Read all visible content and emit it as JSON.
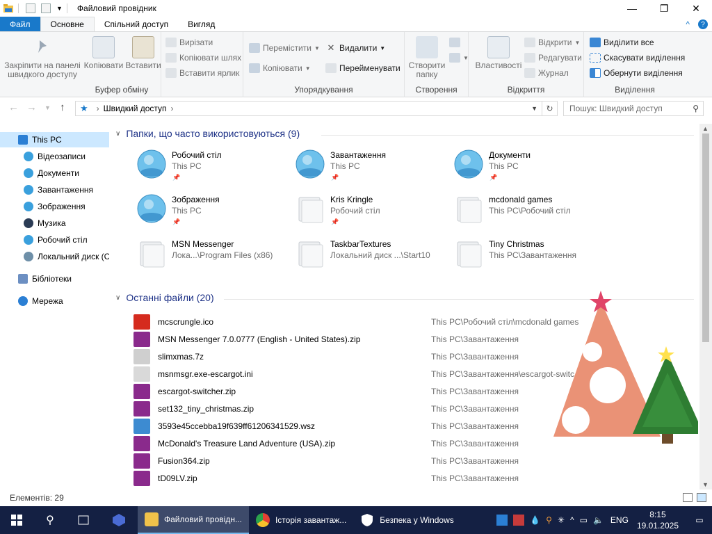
{
  "window": {
    "title": "Файловий провідник",
    "minimize": "—",
    "maximize": "❐",
    "close": "✕"
  },
  "tabs": [
    {
      "label": "Файл"
    },
    {
      "label": "Основне"
    },
    {
      "label": "Спільний доступ"
    },
    {
      "label": "Вигляд"
    }
  ],
  "ribbon": {
    "clipboard": {
      "label": "Буфер обміну",
      "pin_quick": "Закріпити на панелі швидкого доступу",
      "copy": "Копіювати",
      "paste": "Вставити",
      "cut": "Вирізати",
      "copy_path": "Копіювати шлях",
      "paste_shortcut": "Вставити ярлик"
    },
    "organize": {
      "label": "Упорядкування",
      "move_to": "Перемістити",
      "copy_to": "Копіювати",
      "delete": "Видалити",
      "rename": "Перейменувати"
    },
    "new": {
      "label": "Створення",
      "new_folder": "Створити папку"
    },
    "open": {
      "label": "Відкриття",
      "properties": "Властивості",
      "open": "Відкрити",
      "edit": "Редагувати",
      "history": "Журнал"
    },
    "select": {
      "label": "Виділення",
      "select_all": "Виділити все",
      "select_none": "Скасувати виділення",
      "invert": "Обернути виділення"
    }
  },
  "address": {
    "location": "Швидкий доступ",
    "search_placeholder": "Пошук: Швидкий доступ"
  },
  "nav_pane": {
    "items": [
      {
        "label": "This PC",
        "color": "#2b7fd4"
      },
      {
        "label": "Відеозаписи",
        "color": "#3aa0dd"
      },
      {
        "label": "Документи",
        "color": "#3aa0dd"
      },
      {
        "label": "Завантаження",
        "color": "#3aa0dd"
      },
      {
        "label": "Зображення",
        "color": "#3aa0dd"
      },
      {
        "label": "Музика",
        "color": "#2b3c55"
      },
      {
        "label": "Робочий стіл",
        "color": "#3aa0dd"
      },
      {
        "label": "Локальний диск (C",
        "color": "#6e8fa8"
      },
      {
        "label": "Бібліотеки",
        "color": "#6c8fc2"
      },
      {
        "label": "Мережа",
        "color": "#2b7fd4"
      }
    ]
  },
  "frequent": {
    "heading": "Папки, що часто використовуються (9)",
    "items": [
      {
        "name": "Робочий стіл",
        "path": "This PC",
        "pinned": true,
        "kind": "sphere"
      },
      {
        "name": "Завантаження",
        "path": "This PC",
        "pinned": true,
        "kind": "sphere"
      },
      {
        "name": "Документи",
        "path": "This PC",
        "pinned": true,
        "kind": "sphere"
      },
      {
        "name": "Зображення",
        "path": "This PC",
        "pinned": true,
        "kind": "sphere"
      },
      {
        "name": "Kris Kringle",
        "path": "Робочий стіл",
        "pinned": true,
        "kind": "folder"
      },
      {
        "name": "mcdonald games",
        "path": "This PC\\Робочий стіл",
        "pinned": false,
        "kind": "folder"
      },
      {
        "name": "MSN Messenger",
        "path": "Лока...\\Program Files (x86)",
        "pinned": false,
        "kind": "folder"
      },
      {
        "name": "TaskbarTextures",
        "path": "Локальний диск ...\\Start10",
        "pinned": false,
        "kind": "folder"
      },
      {
        "name": "Tiny Christmas",
        "path": "This PC\\Завантаження",
        "pinned": false,
        "kind": "folder"
      }
    ]
  },
  "recent": {
    "heading": "Останні файли (20)",
    "items": [
      {
        "name": "mcscrungle.ico",
        "path": "This PC\\Робочий стіл\\mcdonald games",
        "icon": "#d52b1e"
      },
      {
        "name": "MSN Messenger 7.0.0777 (English - United States).zip",
        "path": "This PC\\Завантаження",
        "icon": "#8a2a8c"
      },
      {
        "name": "slimxmas.7z",
        "path": "This PC\\Завантаження",
        "icon": "#cfcfcf"
      },
      {
        "name": "msnmsgr.exe-escargot.ini",
        "path": "This PC\\Завантаження\\escargot-switc",
        "icon": "#d9d9d9"
      },
      {
        "name": "escargot-switcher.zip",
        "path": "This PC\\Завантаження",
        "icon": "#8a2a8c"
      },
      {
        "name": "set132_tiny_christmas.zip",
        "path": "This PC\\Завантаження",
        "icon": "#8a2a8c"
      },
      {
        "name": "3593e45ccebba19f639ff61206341529.wsz",
        "path": "This PC\\Завантаження",
        "icon": "#3d8bd1"
      },
      {
        "name": "McDonald's Treasure Land Adventure (USA).zip",
        "path": "This PC\\Завантаження",
        "icon": "#8a2a8c"
      },
      {
        "name": "Fusion364.zip",
        "path": "This PC\\Завантаження",
        "icon": "#8a2a8c"
      },
      {
        "name": "tD09LV.zip",
        "path": "This PC\\Завантаження",
        "icon": "#8a2a8c"
      }
    ]
  },
  "status": {
    "count": "Елементів: 29"
  },
  "taskbar": {
    "apps": [
      {
        "label": "Файловий провідн...",
        "active": true,
        "icon": "#f0c24a"
      },
      {
        "label": "Історія завантаж...",
        "active": false,
        "icon": "#e44134"
      },
      {
        "label": "Безпека у Windows",
        "active": false,
        "icon": "#ffffff"
      }
    ],
    "lang": "ENG",
    "time": "8:15",
    "date": "19.01.2025"
  },
  "colors": {
    "accent": "#1979ca",
    "taskbar": "#142043",
    "heading": "#1e3287",
    "selection": "#cce8ff"
  }
}
